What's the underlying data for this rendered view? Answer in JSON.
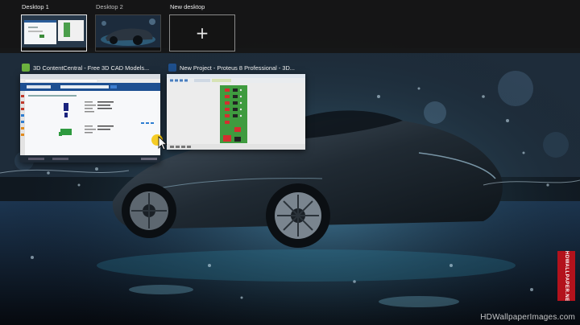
{
  "desktops": [
    {
      "label": "Desktop 1",
      "active": true
    },
    {
      "label": "Desktop 2",
      "active": false
    }
  ],
  "new_desktop": {
    "label": "New desktop",
    "icon": "plus-icon",
    "glyph": "+"
  },
  "windows": [
    {
      "title": "3D ContentCentral - Free 3D CAD Models...",
      "icon": "contentcentral-app-icon",
      "close_glyph": "✕"
    },
    {
      "title": "New Project - Proteus 8 Professional - 3D...",
      "icon": "proteus-app-icon"
    }
  ],
  "watermark": {
    "text": "HDWallpaperImages.com",
    "stamp_text": "HDWALLPAPER.NET"
  },
  "colors": {
    "bar_bg": "#161616",
    "active_border": "#e8e8e8",
    "cc_icon": "#6db33f",
    "proteus_icon": "#1e4f8c",
    "pcb_green": "#4caf50"
  }
}
